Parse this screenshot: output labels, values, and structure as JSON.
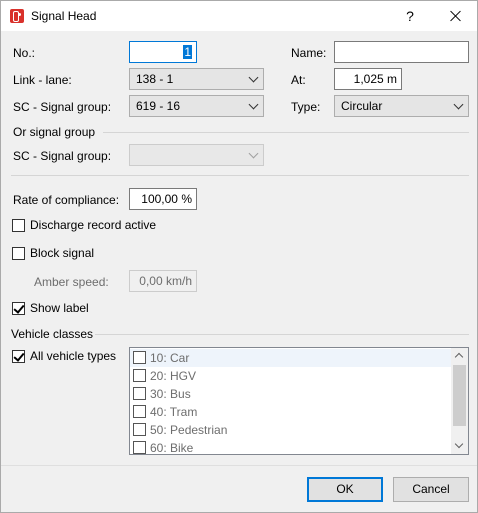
{
  "window": {
    "title": "Signal Head",
    "help": "?"
  },
  "fields": {
    "no_label": "No.:",
    "no_value": "1",
    "name_label": "Name:",
    "name_value": "",
    "link_lane_label": "Link - lane:",
    "link_lane_value": "138 - 1",
    "at_label": "At:",
    "at_value": "1,025 m",
    "sc_group_label": "SC - Signal group:",
    "sc_group_value": "619 - 16",
    "type_label": "Type:",
    "type_value": "Circular"
  },
  "or_signal_group": {
    "heading": "Or signal group",
    "sc_group_label": "SC - Signal group:",
    "sc_group_value": ""
  },
  "compliance": {
    "label": "Rate of compliance:",
    "value": "100,00 %"
  },
  "options": {
    "discharge_label": "Discharge record active",
    "discharge_checked": false,
    "block_label": "Block signal",
    "block_checked": false,
    "amber_label": "Amber speed:",
    "amber_value": "0,00 km/h",
    "show_label_label": "Show label",
    "show_label_checked": true
  },
  "vehicle_classes": {
    "heading": "Vehicle classes",
    "all_label": "All vehicle types",
    "all_checked": true,
    "items": [
      {
        "label": "10: Car",
        "checked": false
      },
      {
        "label": "20: HGV",
        "checked": false
      },
      {
        "label": "30: Bus",
        "checked": false
      },
      {
        "label": "40: Tram",
        "checked": false
      },
      {
        "label": "50: Pedestrian",
        "checked": false
      },
      {
        "label": "60: Bike",
        "checked": false
      }
    ]
  },
  "buttons": {
    "ok": "OK",
    "cancel": "Cancel"
  },
  "colors": {
    "accent": "#0078d7",
    "title_icon": "#d9312b"
  }
}
